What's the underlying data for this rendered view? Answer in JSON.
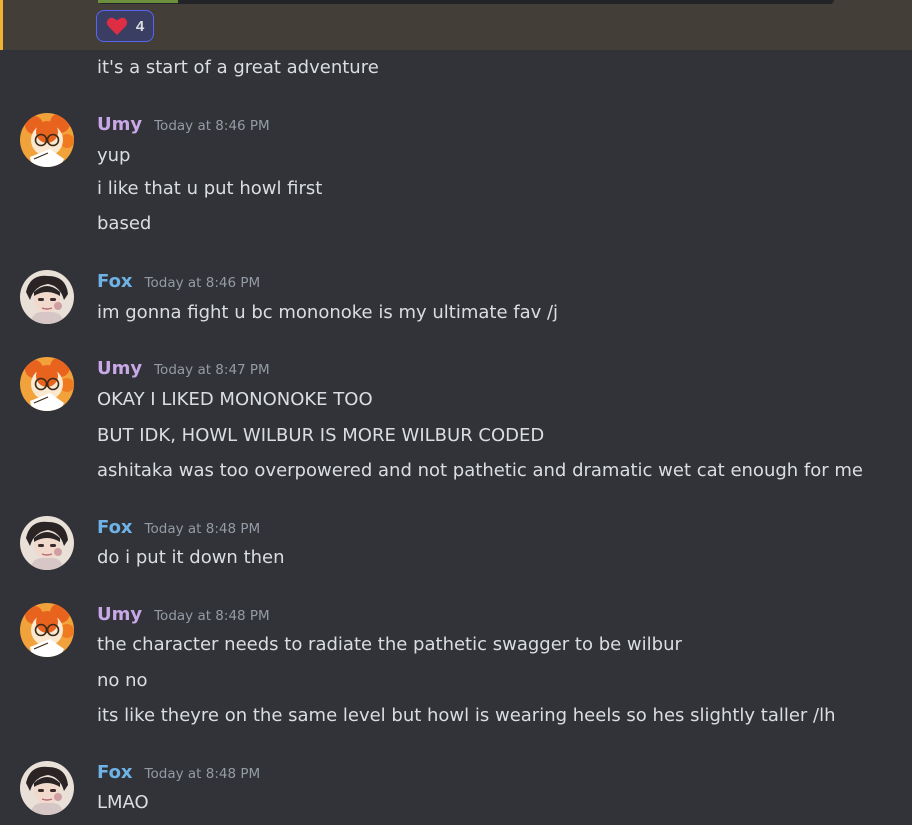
{
  "colors": {
    "background": "#313338",
    "highlight": "#433e38",
    "umy_name": "#c9a8e8",
    "fox_name": "#6fb3e6",
    "text": "#dbdee1",
    "timestamp": "#949ba4",
    "reaction_border": "#5865f2"
  },
  "reaction": {
    "emoji": "heart-icon",
    "count": "4"
  },
  "first_line": "it's a start of a great adventure",
  "messages": [
    {
      "author": "Umy",
      "time": "Today at 8:46 PM",
      "lines": [
        "yup",
        "i like that u put howl first",
        "based"
      ]
    },
    {
      "author": "Fox",
      "time": "Today at 8:46 PM",
      "lines": [
        "im gonna fight u bc mononoke is my ultimate fav /j"
      ]
    },
    {
      "author": "Umy",
      "time": "Today at 8:47 PM",
      "lines": [
        "OKAY I LIKED MONONOKE TOO",
        "BUT IDK, HOWL WILBUR IS MORE WILBUR CODED",
        "ashitaka was too overpowered and not pathetic and dramatic wet cat enough for me"
      ]
    },
    {
      "author": "Fox",
      "time": "Today at 8:48 PM",
      "lines": [
        "do i put it down then"
      ]
    },
    {
      "author": "Umy",
      "time": "Today at 8:48 PM",
      "lines": [
        "the character needs to radiate the pathetic swagger to be  wilbur",
        "no no",
        "its like theyre on the same level but howl is wearing heels so hes slightly taller /lh"
      ]
    },
    {
      "author": "Fox",
      "time": "Today at 8:48 PM",
      "lines": [
        "LMAO"
      ]
    }
  ]
}
